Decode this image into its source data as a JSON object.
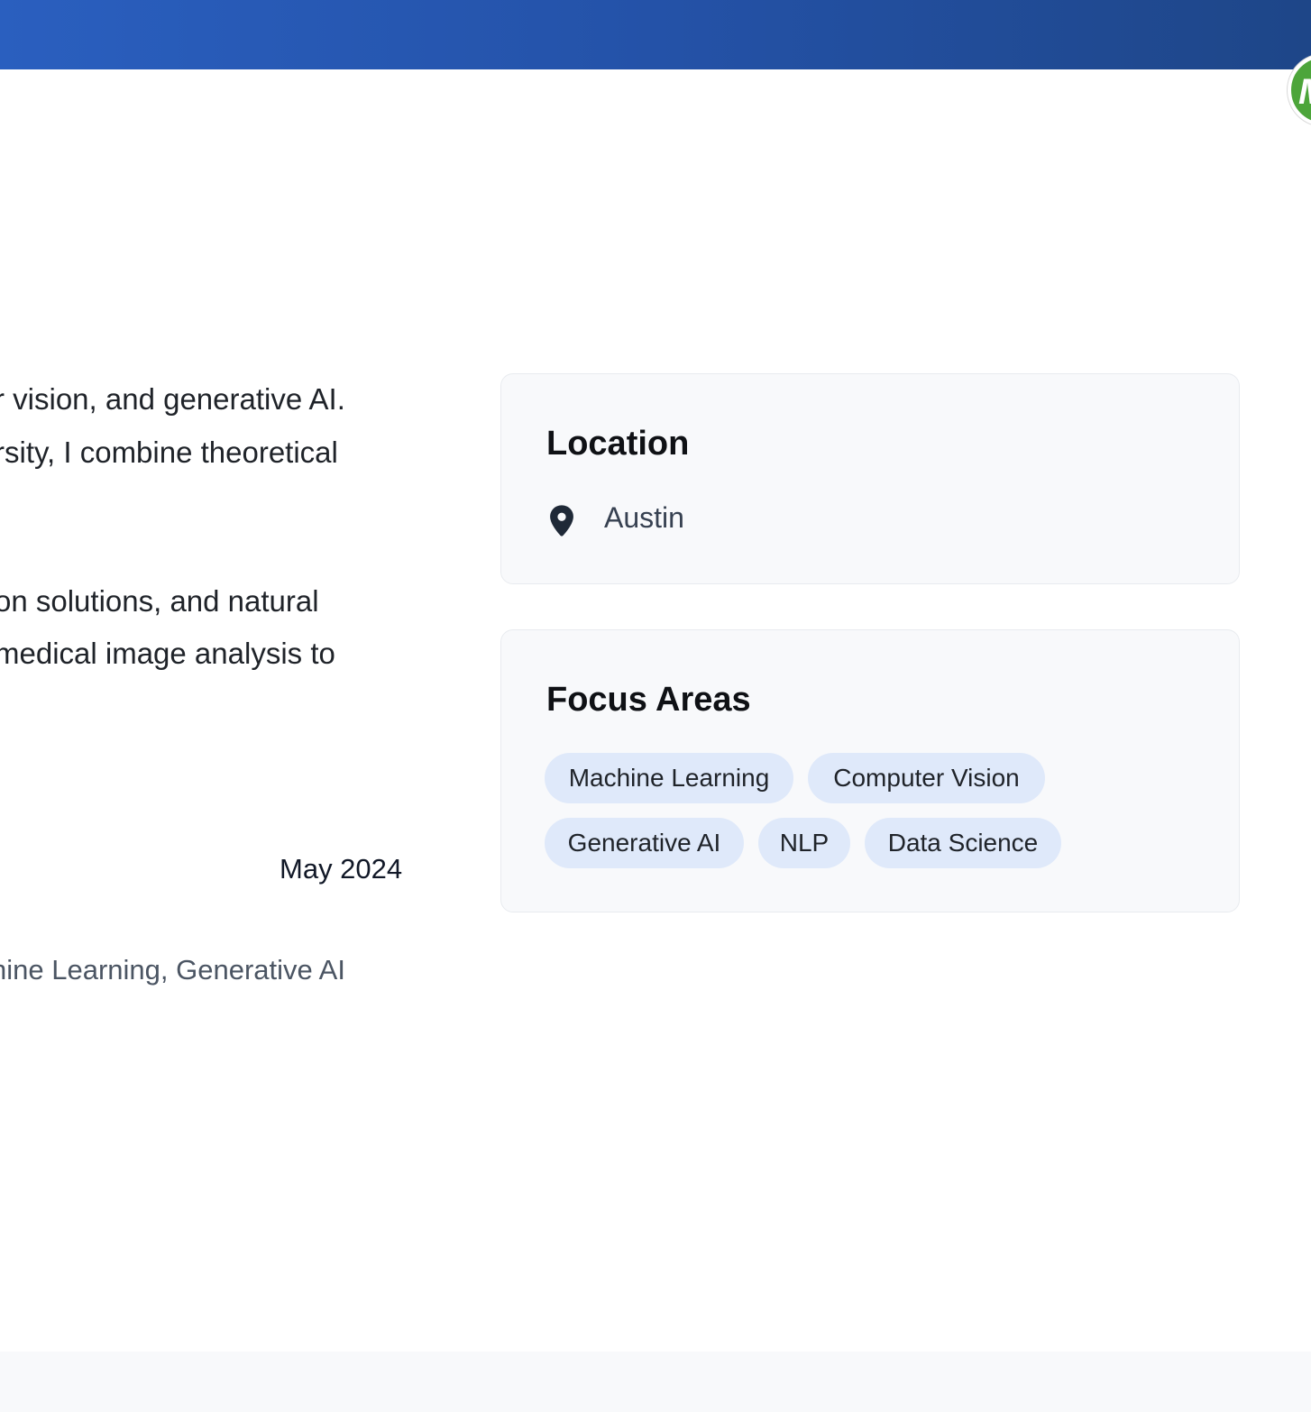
{
  "header": {
    "avatar_initial": "M"
  },
  "bio": {
    "line1": "r vision, and generative AI.",
    "line2": "rsity, I combine theoretical",
    "line3": "on solutions, and natural",
    "line4": "medical image analysis to"
  },
  "entry": {
    "date": "May 2024",
    "tags_text": "hine Learning, Generative AI"
  },
  "location_card": {
    "title": "Location",
    "icon": "map-pin-icon",
    "city": "Austin"
  },
  "focus_card": {
    "title": "Focus Areas",
    "chips": [
      "Machine Learning",
      "Computer Vision",
      "Generative AI",
      "NLP",
      "Data Science"
    ]
  },
  "colors": {
    "header_start": "#2a5fbf",
    "header_end": "#1e4688",
    "chip_bg": "#dfe9fa",
    "card_bg": "#f8f9fb",
    "avatar_bg": "#4ca53a"
  }
}
